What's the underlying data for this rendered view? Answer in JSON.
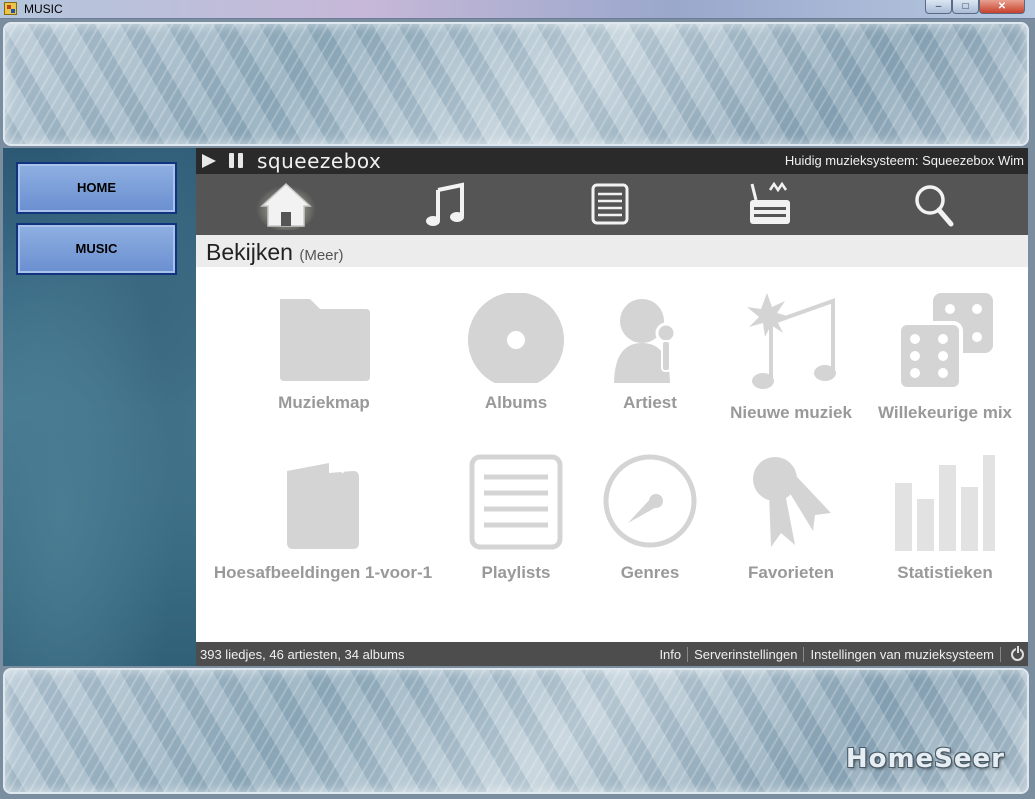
{
  "window": {
    "title": "MUSIC",
    "minimize_glyph": "–",
    "maximize_glyph": "□",
    "close_glyph": "✕"
  },
  "sidebar": {
    "items": [
      {
        "label": "HOME"
      },
      {
        "label": "MUSIC"
      }
    ]
  },
  "branding": {
    "logo": "HomeSeer"
  },
  "squeezebox": {
    "logo": "squeezebox",
    "current_player": "Huidig muzieksysteem: Squeezebox Wim",
    "toolbar": [
      "home-icon",
      "music-note-icon",
      "list-icon",
      "radio-icon",
      "search-icon"
    ],
    "section_title": "Bekijken",
    "section_more": "(Meer)",
    "tiles": [
      {
        "label": "Muziekmap",
        "icon": "folder-icon"
      },
      {
        "label": "Albums",
        "icon": "disc-icon"
      },
      {
        "label": "Artiest",
        "icon": "artist-icon"
      },
      {
        "label": "Nieuwe muziek",
        "icon": "new-music-icon"
      },
      {
        "label": "Willekeurige mix",
        "icon": "dice-icon"
      },
      {
        "label": "Hoesafbeeldingen 1-voor-1",
        "icon": "cover-art-icon"
      },
      {
        "label": "Playlists",
        "icon": "playlist-icon"
      },
      {
        "label": "Genres",
        "icon": "genres-icon"
      },
      {
        "label": "Favorieten",
        "icon": "favorites-icon"
      },
      {
        "label": "Statistieken",
        "icon": "statistics-icon"
      }
    ],
    "status": {
      "counts": "393 liedjes, 46 artiesten, 34 albums",
      "links": [
        "Info",
        "Serverinstellingen",
        "Instellingen van muzieksysteem"
      ]
    }
  },
  "colors": {
    "nav_button": "#7a9ed8",
    "nav_border": "#12347e",
    "tile_icon": "#d4d4d4",
    "tile_label": "#999999",
    "toolbar_bg": "#555555",
    "topbar_bg": "#2a2a2a"
  }
}
